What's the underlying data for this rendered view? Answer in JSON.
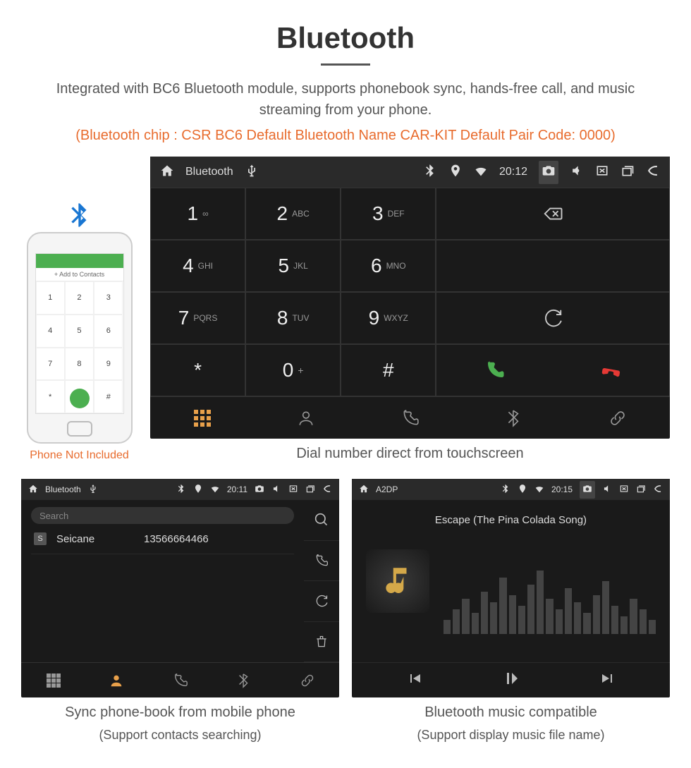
{
  "title": "Bluetooth",
  "description": "Integrated with BC6 Bluetooth module, supports phonebook sync, hands-free call, and music streaming from your phone.",
  "info": "(Bluetooth chip : CSR BC6    Default Bluetooth Name CAR-KIT    Default Pair Code: 0000)",
  "phone": {
    "add_contact": "+  Add to Contacts",
    "caption": "Phone Not Included"
  },
  "dialer": {
    "status_title": "Bluetooth",
    "status_time": "20:12",
    "keys": [
      {
        "num": "1",
        "let": "∞"
      },
      {
        "num": "2",
        "let": "ABC"
      },
      {
        "num": "3",
        "let": "DEF"
      },
      {
        "num": "4",
        "let": "GHI"
      },
      {
        "num": "5",
        "let": "JKL"
      },
      {
        "num": "6",
        "let": "MNO"
      },
      {
        "num": "7",
        "let": "PQRS"
      },
      {
        "num": "8",
        "let": "TUV"
      },
      {
        "num": "9",
        "let": "WXYZ"
      },
      {
        "num": "*",
        "let": ""
      },
      {
        "num": "0",
        "let": "+",
        "plus": true
      },
      {
        "num": "#",
        "let": ""
      }
    ],
    "caption": "Dial number direct from touchscreen"
  },
  "phonebook": {
    "status_title": "Bluetooth",
    "status_time": "20:11",
    "search_placeholder": "Search",
    "contact_badge": "S",
    "contact_name": "Seicane",
    "contact_number": "13566664466",
    "caption1": "Sync phone-book from mobile phone",
    "caption2": "(Support contacts searching)"
  },
  "music": {
    "status_title": "A2DP",
    "status_time": "20:15",
    "song": "Escape (The Pina Colada Song)",
    "caption1": "Bluetooth music compatible",
    "caption2": "(Support display music file name)"
  }
}
